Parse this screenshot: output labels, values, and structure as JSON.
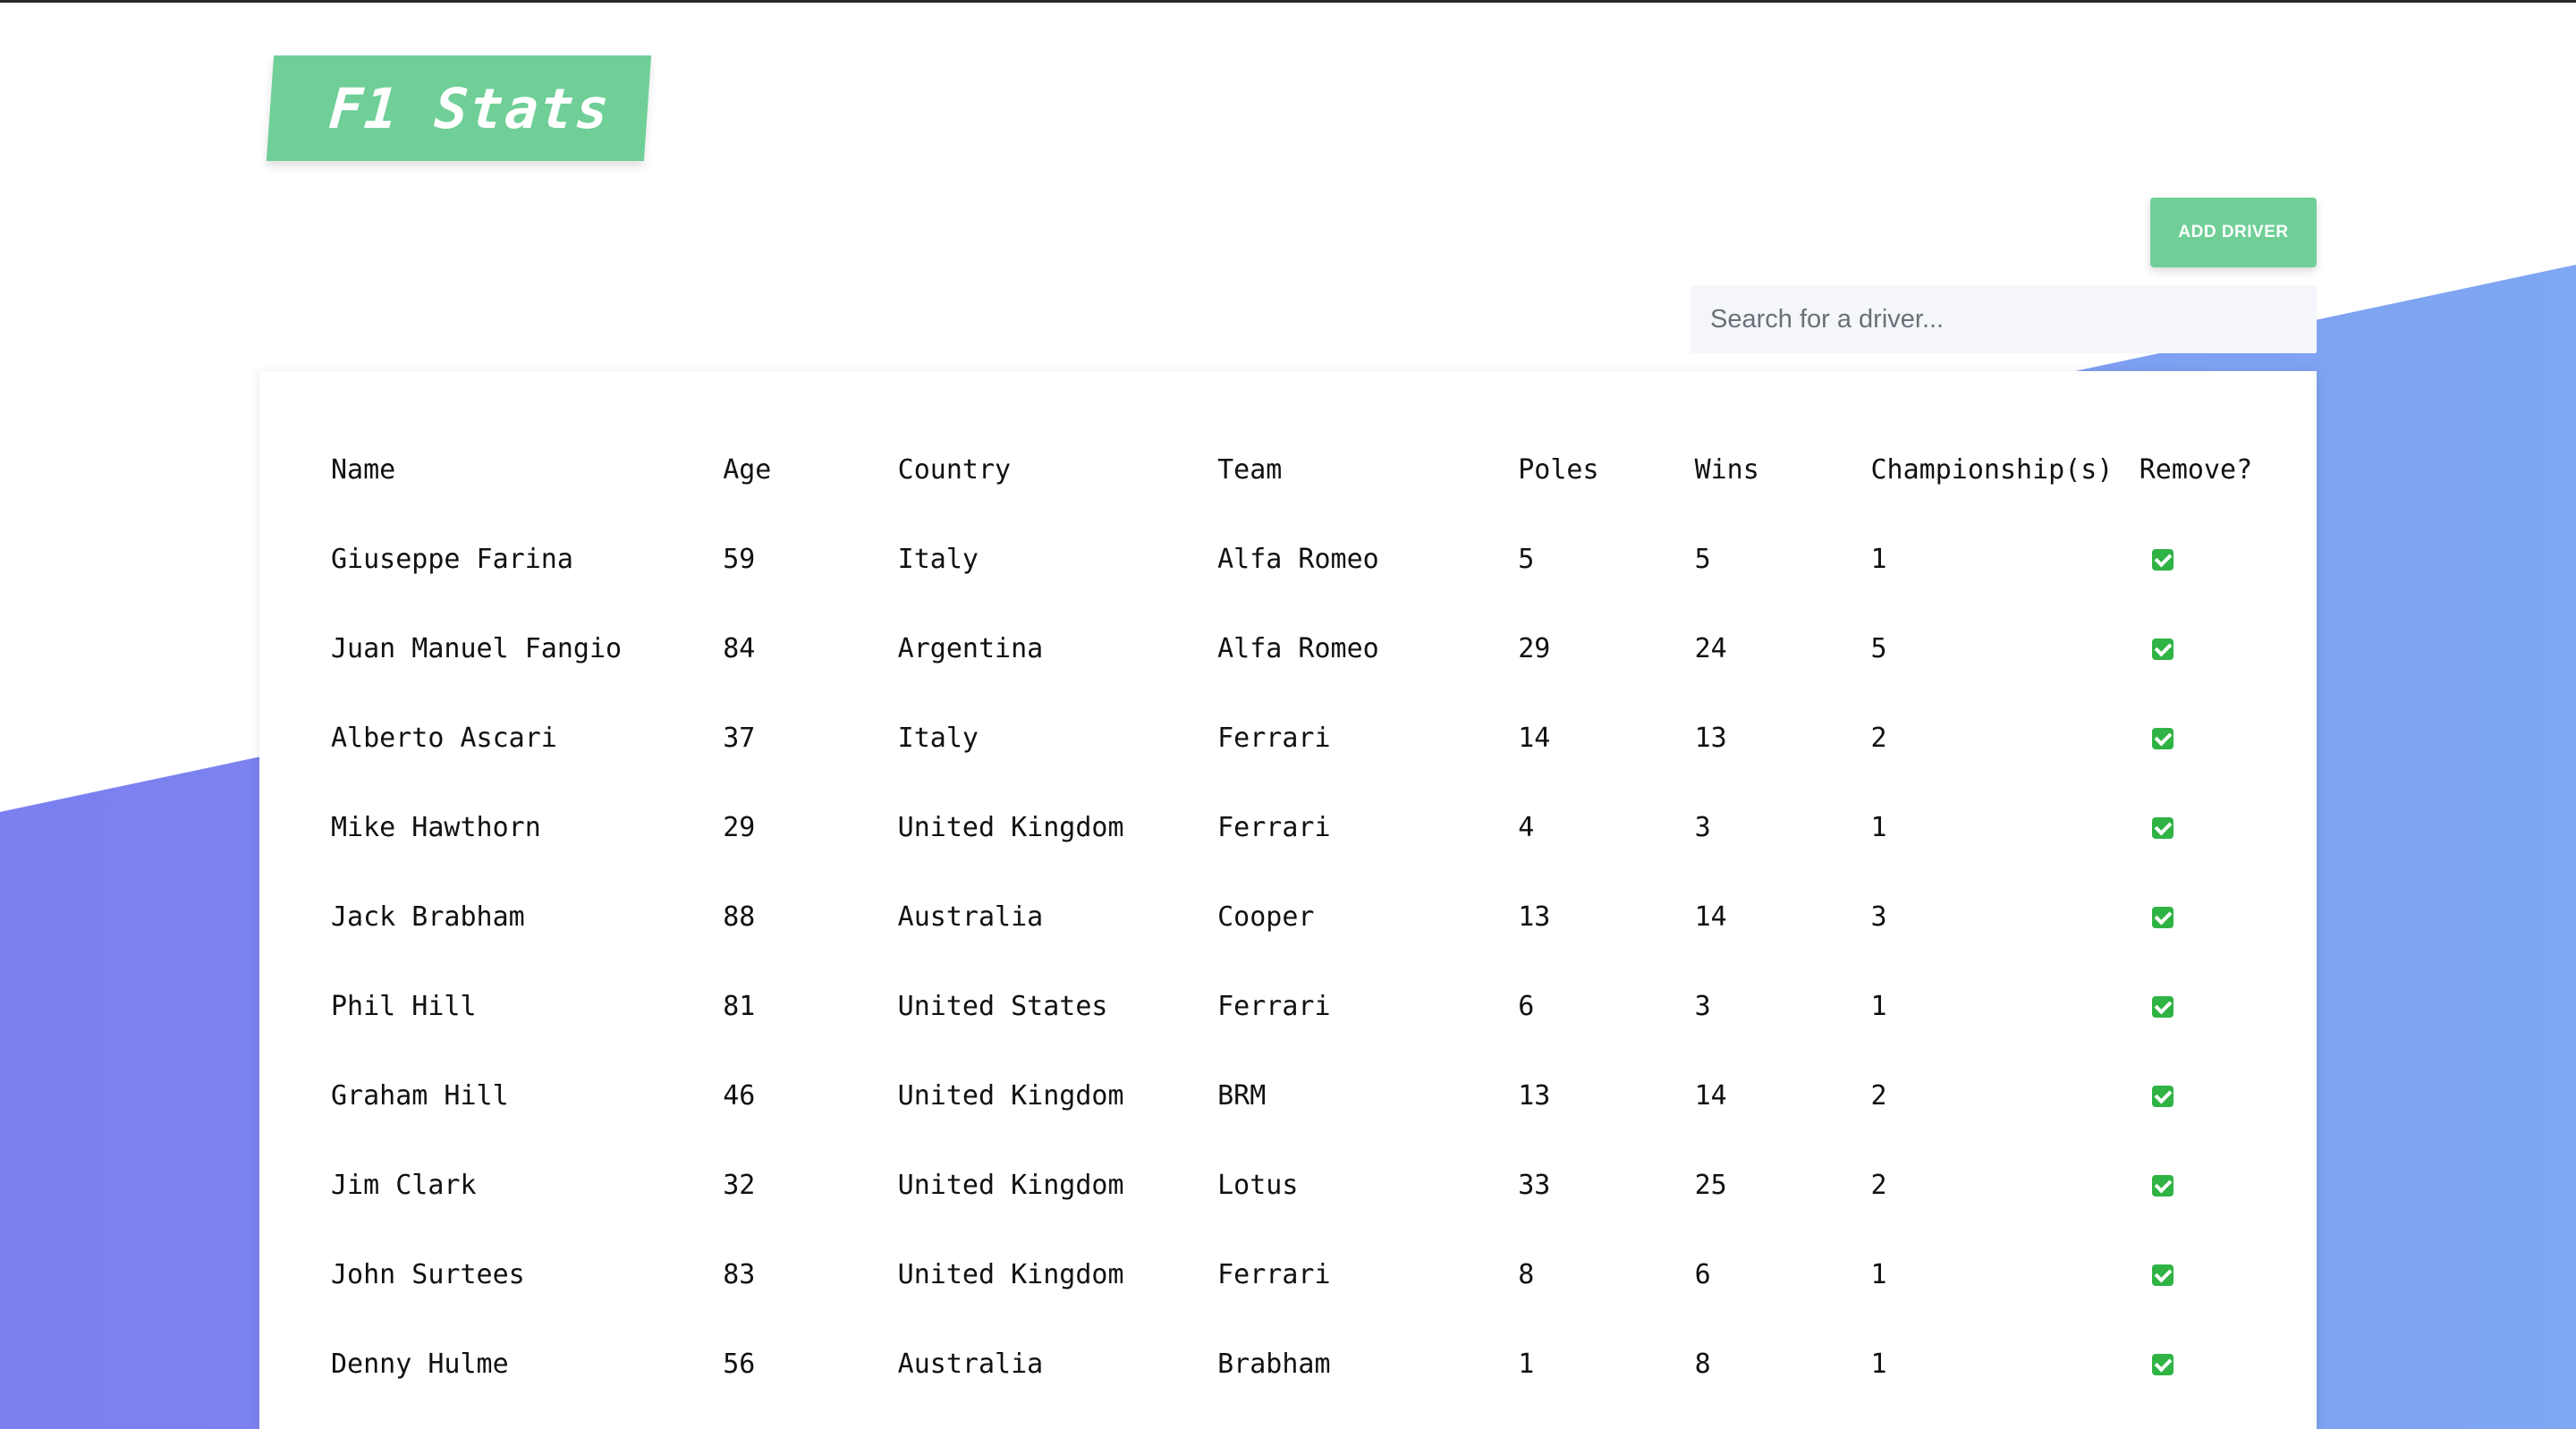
{
  "app": {
    "title": "F1 Stats",
    "add_button_label": "ADD DRIVER",
    "search_placeholder": "Search for a driver..."
  },
  "colors": {
    "accent": "#6fcf97",
    "wave_left": "#7b7ff0",
    "wave_right": "#7fa7f2",
    "check": "#2fb344"
  },
  "table": {
    "headers": {
      "name": "Name",
      "age": "Age",
      "country": "Country",
      "team": "Team",
      "poles": "Poles",
      "wins": "Wins",
      "championships": "Championship(s)",
      "remove": "Remove?"
    },
    "remove_icon": "checkmark-icon",
    "rows": [
      {
        "name": "Giuseppe Farina",
        "age": "59",
        "country": "Italy",
        "team": "Alfa Romeo",
        "poles": "5",
        "wins": "5",
        "championships": "1"
      },
      {
        "name": "Juan Manuel Fangio",
        "age": "84",
        "country": "Argentina",
        "team": "Alfa Romeo",
        "poles": "29",
        "wins": "24",
        "championships": "5"
      },
      {
        "name": "Alberto Ascari",
        "age": "37",
        "country": "Italy",
        "team": "Ferrari",
        "poles": "14",
        "wins": "13",
        "championships": "2"
      },
      {
        "name": "Mike Hawthorn",
        "age": "29",
        "country": "United Kingdom",
        "team": "Ferrari",
        "poles": "4",
        "wins": "3",
        "championships": "1"
      },
      {
        "name": "Jack Brabham",
        "age": "88",
        "country": "Australia",
        "team": "Cooper",
        "poles": "13",
        "wins": "14",
        "championships": "3"
      },
      {
        "name": "Phil Hill",
        "age": "81",
        "country": "United States",
        "team": "Ferrari",
        "poles": "6",
        "wins": "3",
        "championships": "1"
      },
      {
        "name": "Graham Hill",
        "age": "46",
        "country": "United Kingdom",
        "team": "BRM",
        "poles": "13",
        "wins": "14",
        "championships": "2"
      },
      {
        "name": "Jim Clark",
        "age": "32",
        "country": "United Kingdom",
        "team": "Lotus",
        "poles": "33",
        "wins": "25",
        "championships": "2"
      },
      {
        "name": "John Surtees",
        "age": "83",
        "country": "United Kingdom",
        "team": "Ferrari",
        "poles": "8",
        "wins": "6",
        "championships": "1"
      },
      {
        "name": "Denny Hulme",
        "age": "56",
        "country": "Australia",
        "team": "Brabham",
        "poles": "1",
        "wins": "8",
        "championships": "1"
      }
    ]
  }
}
